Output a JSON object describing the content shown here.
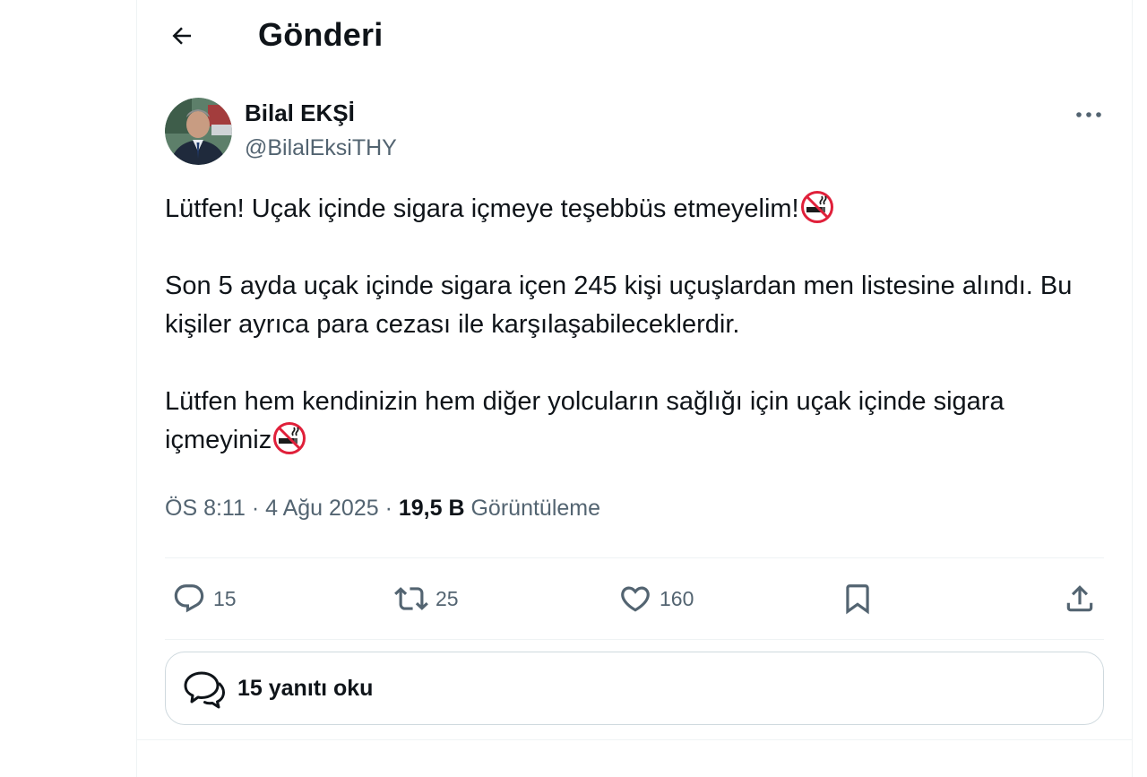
{
  "header": {
    "title": "Gönderi"
  },
  "author": {
    "name": "Bilal EKŞİ",
    "handle": "@BilalEksiTHY"
  },
  "tweet": {
    "line1": "Lütfen! Uçak içinde sigara içmeye teşebbüs etmeyelim!",
    "paragraph2": "Son 5 ayda uçak içinde sigara içen 245 kişi uçuşlardan men listesine alındı. Bu kişiler ayrıca para cezası ile karşılaşabileceklerdir.",
    "paragraph3": "Lütfen hem kendinizin  hem diğer yolcuların sağlığı için uçak içinde sigara içmeyiniz",
    "emoji_icon": "no-smoking-icon"
  },
  "meta": {
    "time": "ÖS 8:11",
    "date": "4 Ağu 2025",
    "separator": "·",
    "views_count": "19,5 B",
    "views_label": "Görüntüleme"
  },
  "actions": {
    "replies": "15",
    "reposts": "25",
    "likes": "160"
  },
  "read_replies": {
    "label": "15 yanıtı oku"
  },
  "colors": {
    "text": "#0f1419",
    "secondary": "#536471",
    "border": "#cfd9de",
    "divider": "#eff3f4",
    "no_smoking_red": "#e0203a"
  }
}
